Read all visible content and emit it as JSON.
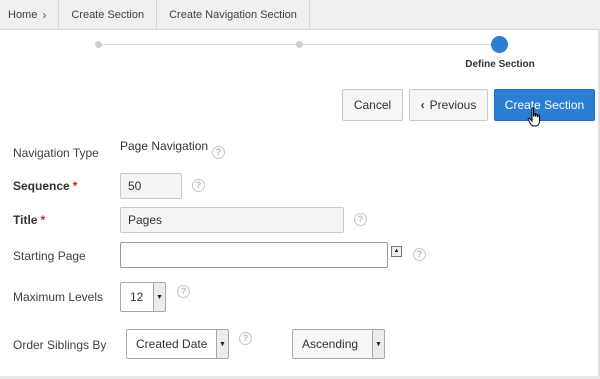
{
  "breadcrumb": {
    "items": [
      {
        "label": "Home"
      },
      {
        "label": "Create Section"
      },
      {
        "label": "Create Navigation Section"
      }
    ]
  },
  "wizard": {
    "current_step": "Define Section",
    "steps_total": 3,
    "current_index": 3
  },
  "toolbar": {
    "cancel_label": "Cancel",
    "previous_label": "Previous",
    "create_label": "Create Section"
  },
  "form": {
    "navigation_type": {
      "label": "Navigation Type",
      "value": "Page Navigation"
    },
    "sequence": {
      "label": "Sequence",
      "value": "50",
      "required": true
    },
    "title": {
      "label": "Title",
      "value": "Pages",
      "required": true
    },
    "starting_page": {
      "label": "Starting Page",
      "value": ""
    },
    "maximum_levels": {
      "label": "Maximum Levels",
      "value": "12"
    },
    "order_siblings_by": {
      "label": "Order Siblings By",
      "value": "Created Date",
      "direction": "Ascending"
    }
  },
  "icons": {
    "help": "help-circle-icon",
    "breadcrumb_separator": "chevron-right-icon",
    "previous": "chevron-left-icon",
    "dropdown": "caret-down-icon",
    "popup": "caret-up-icon",
    "cursor": "hand-pointer-icon"
  },
  "colors": {
    "primary": "#2a7fd3",
    "required": "#e01b1b",
    "wizard_active": "#2e7ed1",
    "wizard_inactive": "#cfcfcf"
  }
}
